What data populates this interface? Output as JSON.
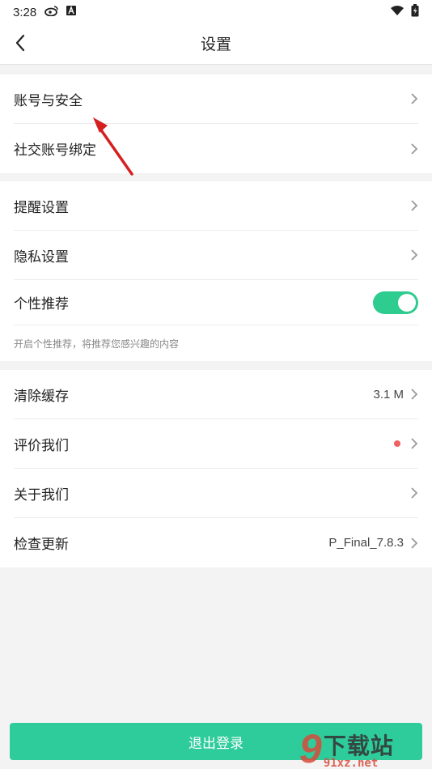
{
  "status_bar": {
    "time": "3:28",
    "icons": [
      "weibo-icon",
      "a-badge-icon",
      "wifi-icon",
      "battery-icon"
    ]
  },
  "nav": {
    "title": "设置",
    "back_icon": "chevron-left-icon"
  },
  "groups": {
    "account": [
      {
        "label": "账号与安全"
      },
      {
        "label": "社交账号绑定"
      }
    ],
    "settings": {
      "reminder": "提醒设置",
      "privacy": "隐私设置",
      "personal": "个性推荐",
      "personal_enabled": true,
      "personal_hint": "开启个性推荐，将推荐您感兴趣的内容"
    },
    "misc": {
      "clear_cache": "清除缓存",
      "cache_size": "3.1 M",
      "rate": "评价我们",
      "about": "关于我们",
      "check_update": "检查更新",
      "version": "P_Final_7.8.3"
    }
  },
  "logout_label": "退出登录",
  "watermark": {
    "big": "9",
    "cn": "下载站",
    "domain": "91xz.net"
  },
  "colors": {
    "accent": "#2ecc9a",
    "toggle_on": "#2ecc8f",
    "dot": "#f06060",
    "annotation_arrow": "#d42020"
  }
}
